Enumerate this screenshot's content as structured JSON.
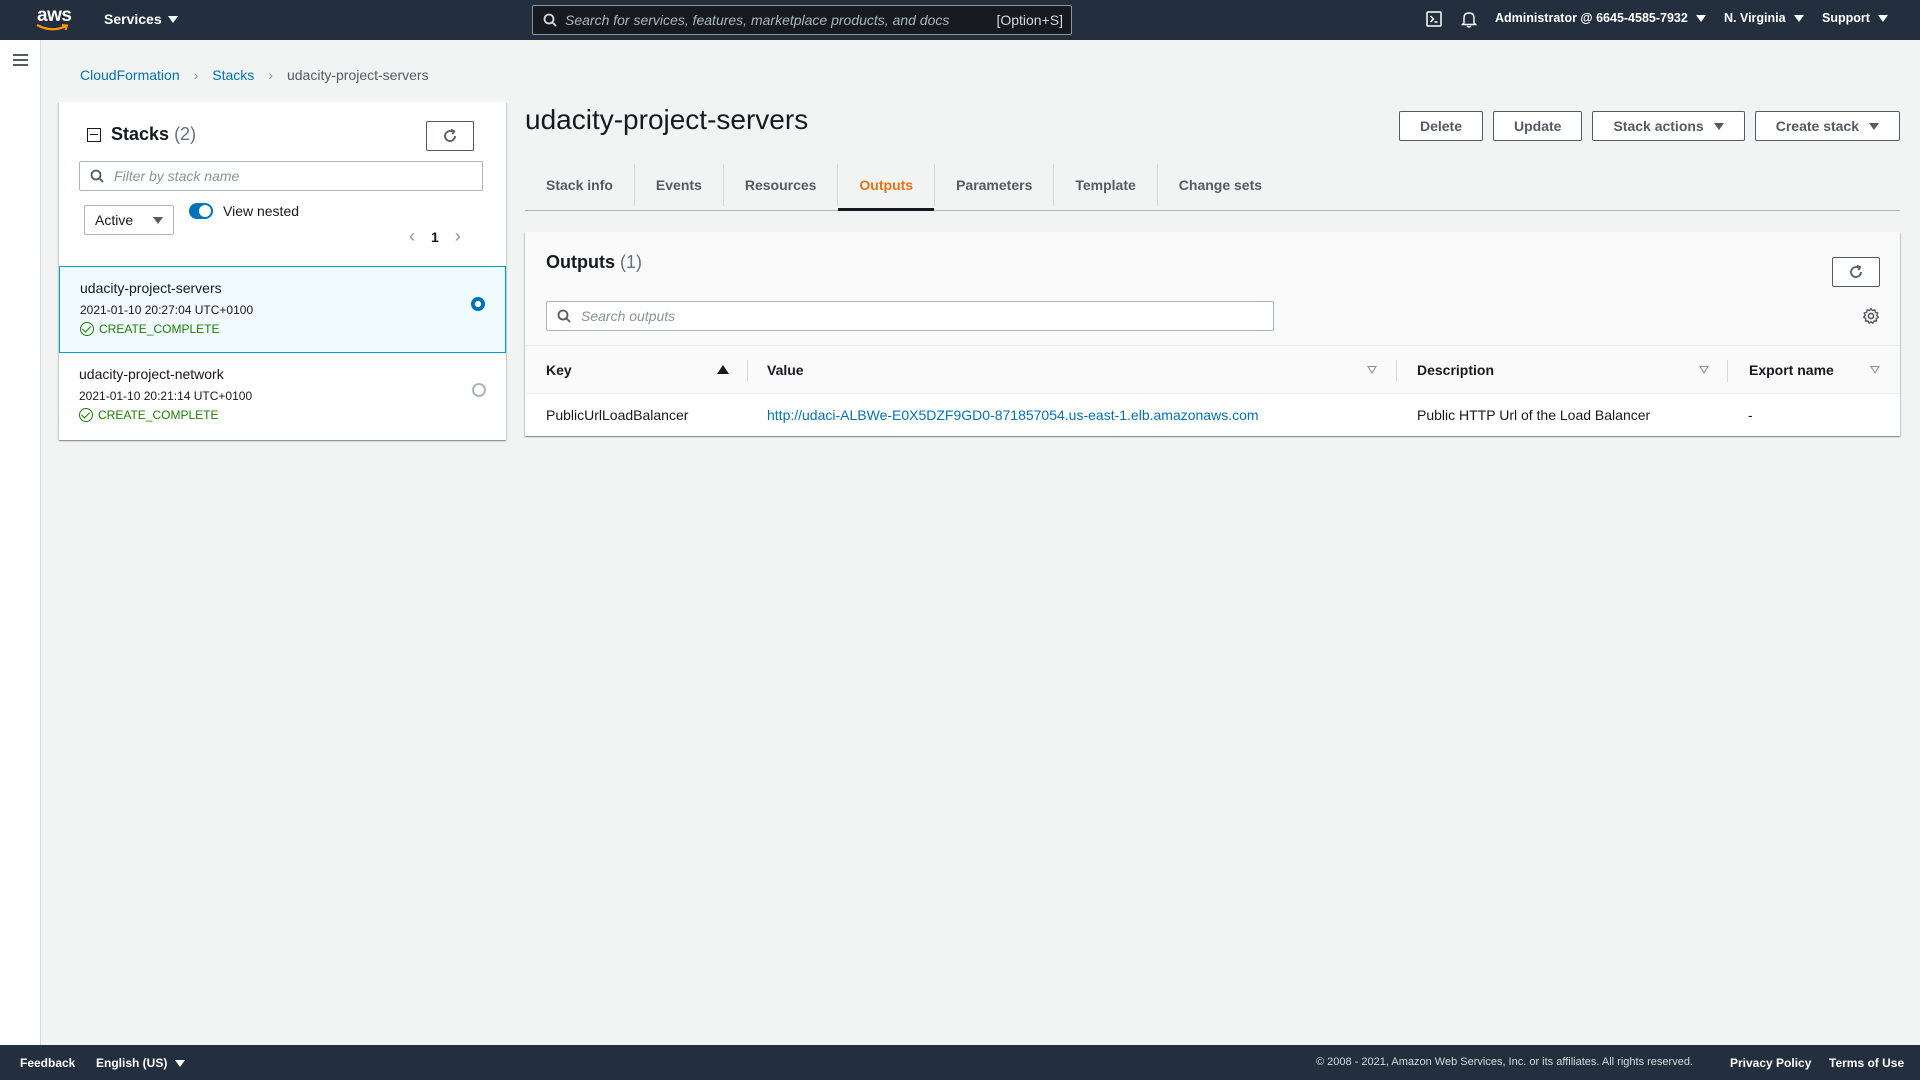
{
  "topnav": {
    "logo": "aws",
    "services_label": "Services",
    "search_placeholder": "Search for services, features, marketplace products, and docs",
    "search_shortcut": "[Option+S]",
    "account_label": "Administrator @ 6645-4585-7932",
    "region_label": "N. Virginia",
    "support_label": "Support"
  },
  "breadcrumb": {
    "items": [
      "CloudFormation",
      "Stacks"
    ],
    "current": "udacity-project-servers"
  },
  "stacks_panel": {
    "title": "Stacks",
    "count": "(2)",
    "filter_placeholder": "Filter by stack name",
    "status_filter": "Active",
    "view_nested_label": "View nested",
    "view_nested_on": true,
    "page_number": "1",
    "stacks": [
      {
        "name": "udacity-project-servers",
        "date": "2021-01-10 20:27:04 UTC+0100",
        "status": "CREATE_COMPLETE",
        "selected": true
      },
      {
        "name": "udacity-project-network",
        "date": "2021-01-10 20:21:14 UTC+0100",
        "status": "CREATE_COMPLETE",
        "selected": false
      }
    ]
  },
  "main": {
    "title": "udacity-project-servers",
    "actions": {
      "delete": "Delete",
      "update": "Update",
      "stack_actions": "Stack actions",
      "create_stack": "Create stack"
    },
    "tabs": [
      {
        "label": "Stack info",
        "active": false
      },
      {
        "label": "Events",
        "active": false
      },
      {
        "label": "Resources",
        "active": false
      },
      {
        "label": "Outputs",
        "active": true
      },
      {
        "label": "Parameters",
        "active": false
      },
      {
        "label": "Template",
        "active": false
      },
      {
        "label": "Change sets",
        "active": false
      }
    ]
  },
  "outputs": {
    "title": "Outputs",
    "count": "(1)",
    "search_placeholder": "Search outputs",
    "columns": [
      "Key",
      "Value",
      "Description",
      "Export name"
    ],
    "rows": [
      {
        "key": "PublicUrlLoadBalancer",
        "value": "http://udaci-ALBWe-E0X5DZF9GD0-871857054.us-east-1.elb.amazonaws.com",
        "description": "Public HTTP Url of the Load Balancer",
        "export_name": "-"
      }
    ]
  },
  "footer": {
    "feedback": "Feedback",
    "language": "English (US)",
    "copyright": "© 2008 - 2021, Amazon Web Services, Inc. or its affiliates. All rights reserved.",
    "privacy": "Privacy Policy",
    "terms": "Terms of Use"
  },
  "colors": {
    "nav_bg": "#232f3e",
    "link": "#0073bb",
    "active_tab": "#ec7211",
    "success": "#1d8102",
    "page_bg": "#f2f3f3"
  }
}
